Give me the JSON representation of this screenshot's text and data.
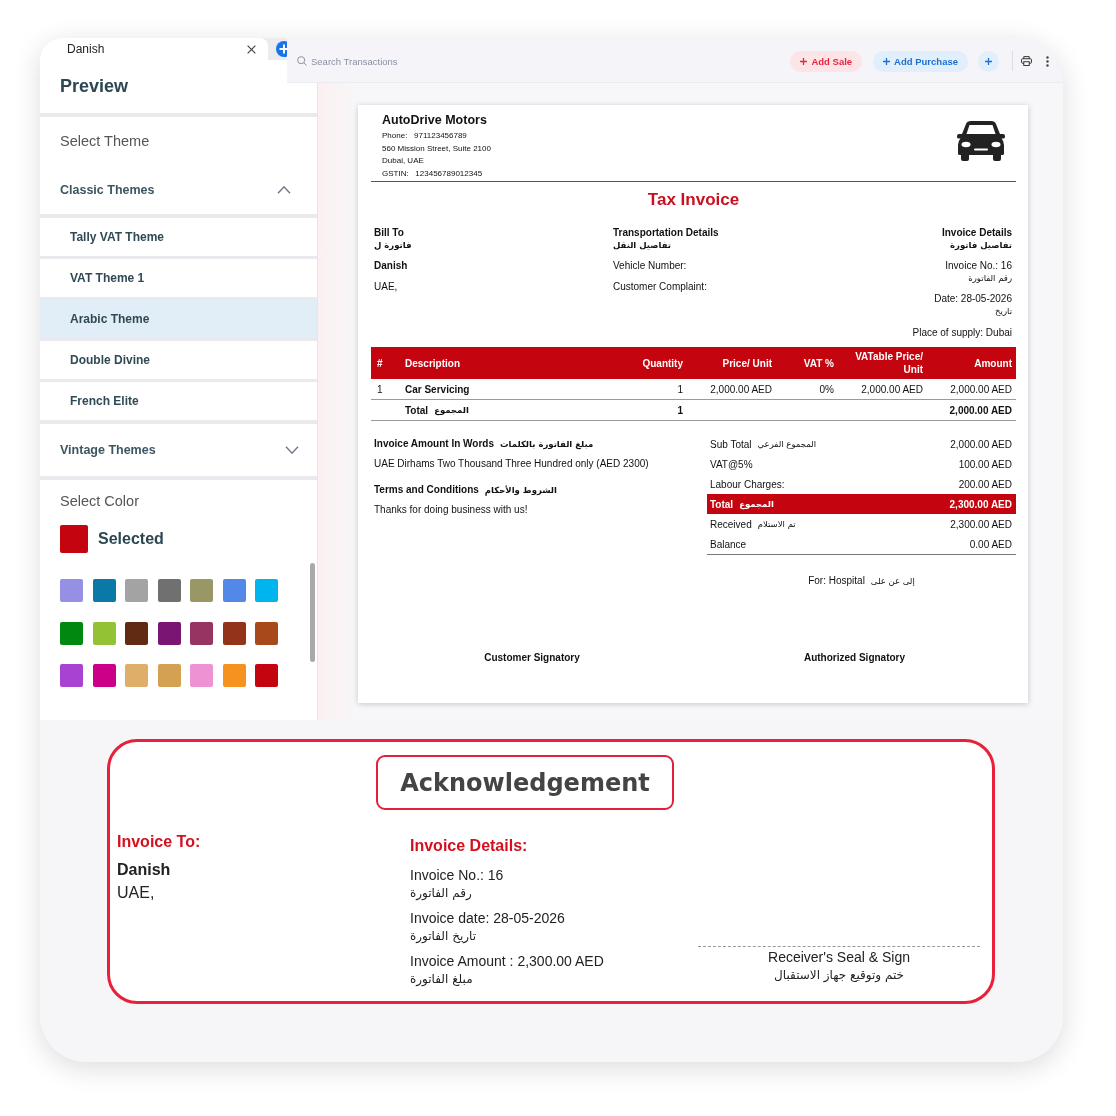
{
  "tab": {
    "label": "Danish"
  },
  "search": {
    "placeholder": "Search Transactions"
  },
  "toolbar_buttons": [
    {
      "kind": "sale",
      "label": "Add Sale"
    },
    {
      "kind": "purchase",
      "label": "Add Purchase"
    }
  ],
  "sidebar": {
    "title": "Preview",
    "theme_heading": "Select Theme",
    "groups": [
      {
        "label": "Classic Themes",
        "expanded": true,
        "items": [
          {
            "label": "Tally VAT Theme",
            "selected": false
          },
          {
            "label": "VAT Theme 1",
            "selected": false
          },
          {
            "label": "Arabic Theme",
            "selected": true
          },
          {
            "label": "Double Divine",
            "selected": false
          },
          {
            "label": "French Elite",
            "selected": false
          }
        ]
      },
      {
        "label": "Vintage Themes",
        "expanded": false
      }
    ],
    "color_heading": "Select Color",
    "selected_color": {
      "label": "Selected",
      "color": "#c40510"
    },
    "swatches": [
      {
        "color": "#9590e3"
      },
      {
        "color": "#0b79a8"
      },
      {
        "color": "#a3a3a3"
      },
      {
        "color": "#707070"
      },
      {
        "color": "#999766"
      },
      {
        "color": "#5288e8"
      },
      {
        "color": "#00b5ee"
      },
      {
        "color": "#008811"
      },
      {
        "color": "#93c334"
      },
      {
        "color": "#612a12"
      },
      {
        "color": "#7b1573"
      },
      {
        "color": "#983462"
      },
      {
        "color": "#933319"
      },
      {
        "color": "#a8491c"
      },
      {
        "color": "#a842d3"
      },
      {
        "color": "#cc0088"
      },
      {
        "color": "#dfae68"
      },
      {
        "color": "#d4a052"
      },
      {
        "color": "#ed93d4"
      },
      {
        "color": "#f6921e"
      },
      {
        "color": "#c40510"
      }
    ]
  },
  "invoice": {
    "company": {
      "name": "AutoDrive Motors",
      "lines": [
        "Phone:   971123456789",
        "560 Mission Street, Suite 2100",
        "Dubai, UAE",
        "GSTIN:   123456789012345"
      ]
    },
    "title": "Tax Invoice",
    "bill_to": {
      "heading": "Bill To",
      "heading_ar": "فاتورة ل",
      "name": "Danish",
      "address": "UAE,"
    },
    "transport": {
      "heading": "Transportation Details",
      "heading_ar": "تفاصيل النقل",
      "fields": [
        "Vehicle Number:",
        "Customer Complaint:"
      ]
    },
    "details": {
      "heading": "Invoice Details",
      "heading_ar": "تفاصيل فاتورة",
      "lines": [
        {
          "text": "Invoice No.: 16",
          "ar": "رقم الفاتورة"
        },
        {
          "text": "Date: 28-05-2026",
          "ar": "تاريخ"
        },
        {
          "text": "Place of supply: Dubai"
        }
      ]
    },
    "table": {
      "columns": [
        "#",
        "Description",
        "Quantity",
        "Price/ Unit",
        "VAT %",
        "VATable Price/ Unit",
        "Amount"
      ],
      "rows": [
        [
          "1",
          "Car Servicing",
          "1",
          "2,000.00 AED",
          "0%",
          "2,000.00 AED",
          "2,000.00 AED"
        ]
      ],
      "total": {
        "label": "Total",
        "label_ar": "المجموع",
        "quantity": "1",
        "amount": "2,000.00 AED"
      }
    },
    "words": {
      "heading": "Invoice Amount In Words",
      "heading_ar": "مبلغ الفاتورة بالكلمات",
      "text": "UAE Dirhams Two Thousand Three Hundred only (AED 2300)"
    },
    "terms": {
      "heading": "Terms and Conditions",
      "heading_ar": "الشروط والأحكام",
      "text": "Thanks for doing business with us!"
    },
    "summary": [
      {
        "kind": "line",
        "label": "Sub Total",
        "label_ar": "المجموع الفرعي",
        "value": "2,000.00 AED"
      },
      {
        "kind": "line",
        "label": "VAT@5%",
        "value": "100.00 AED"
      },
      {
        "kind": "line",
        "label": "Labour Charges:",
        "value": "200.00 AED"
      },
      {
        "kind": "total",
        "label": "Total",
        "label_ar": "المجموع",
        "value": "2,300.00 AED"
      },
      {
        "kind": "line",
        "label": "Received",
        "label_ar": "تم الاستلام",
        "value": "2,300.00 AED"
      },
      {
        "kind": "line",
        "label": "Balance",
        "value": "0.00 AED"
      }
    ],
    "for": {
      "text": "For: Hospital",
      "ar": "إلى عن على"
    },
    "signatures": [
      "Customer Signatory",
      "Authorized Signatory"
    ]
  },
  "acknowledgement": {
    "title": "Acknowledgement",
    "to": {
      "heading": "Invoice To:",
      "name": "Danish",
      "address": "UAE,"
    },
    "details": {
      "heading": "Invoice Details:",
      "lines": [
        {
          "text": "Invoice No.: 16",
          "ar": "رقم الفاتورة"
        },
        {
          "text": "Invoice date: 28-05-2026",
          "ar": "تاريخ الفاتورة"
        },
        {
          "text": "Invoice Amount : 2,300.00 AED",
          "ar": "مبلغ الفاتورة"
        }
      ]
    },
    "seal": {
      "text": "Receiver's Seal & Sign",
      "ar": "ختم وتوقيع جهاز الاستقبال"
    }
  }
}
